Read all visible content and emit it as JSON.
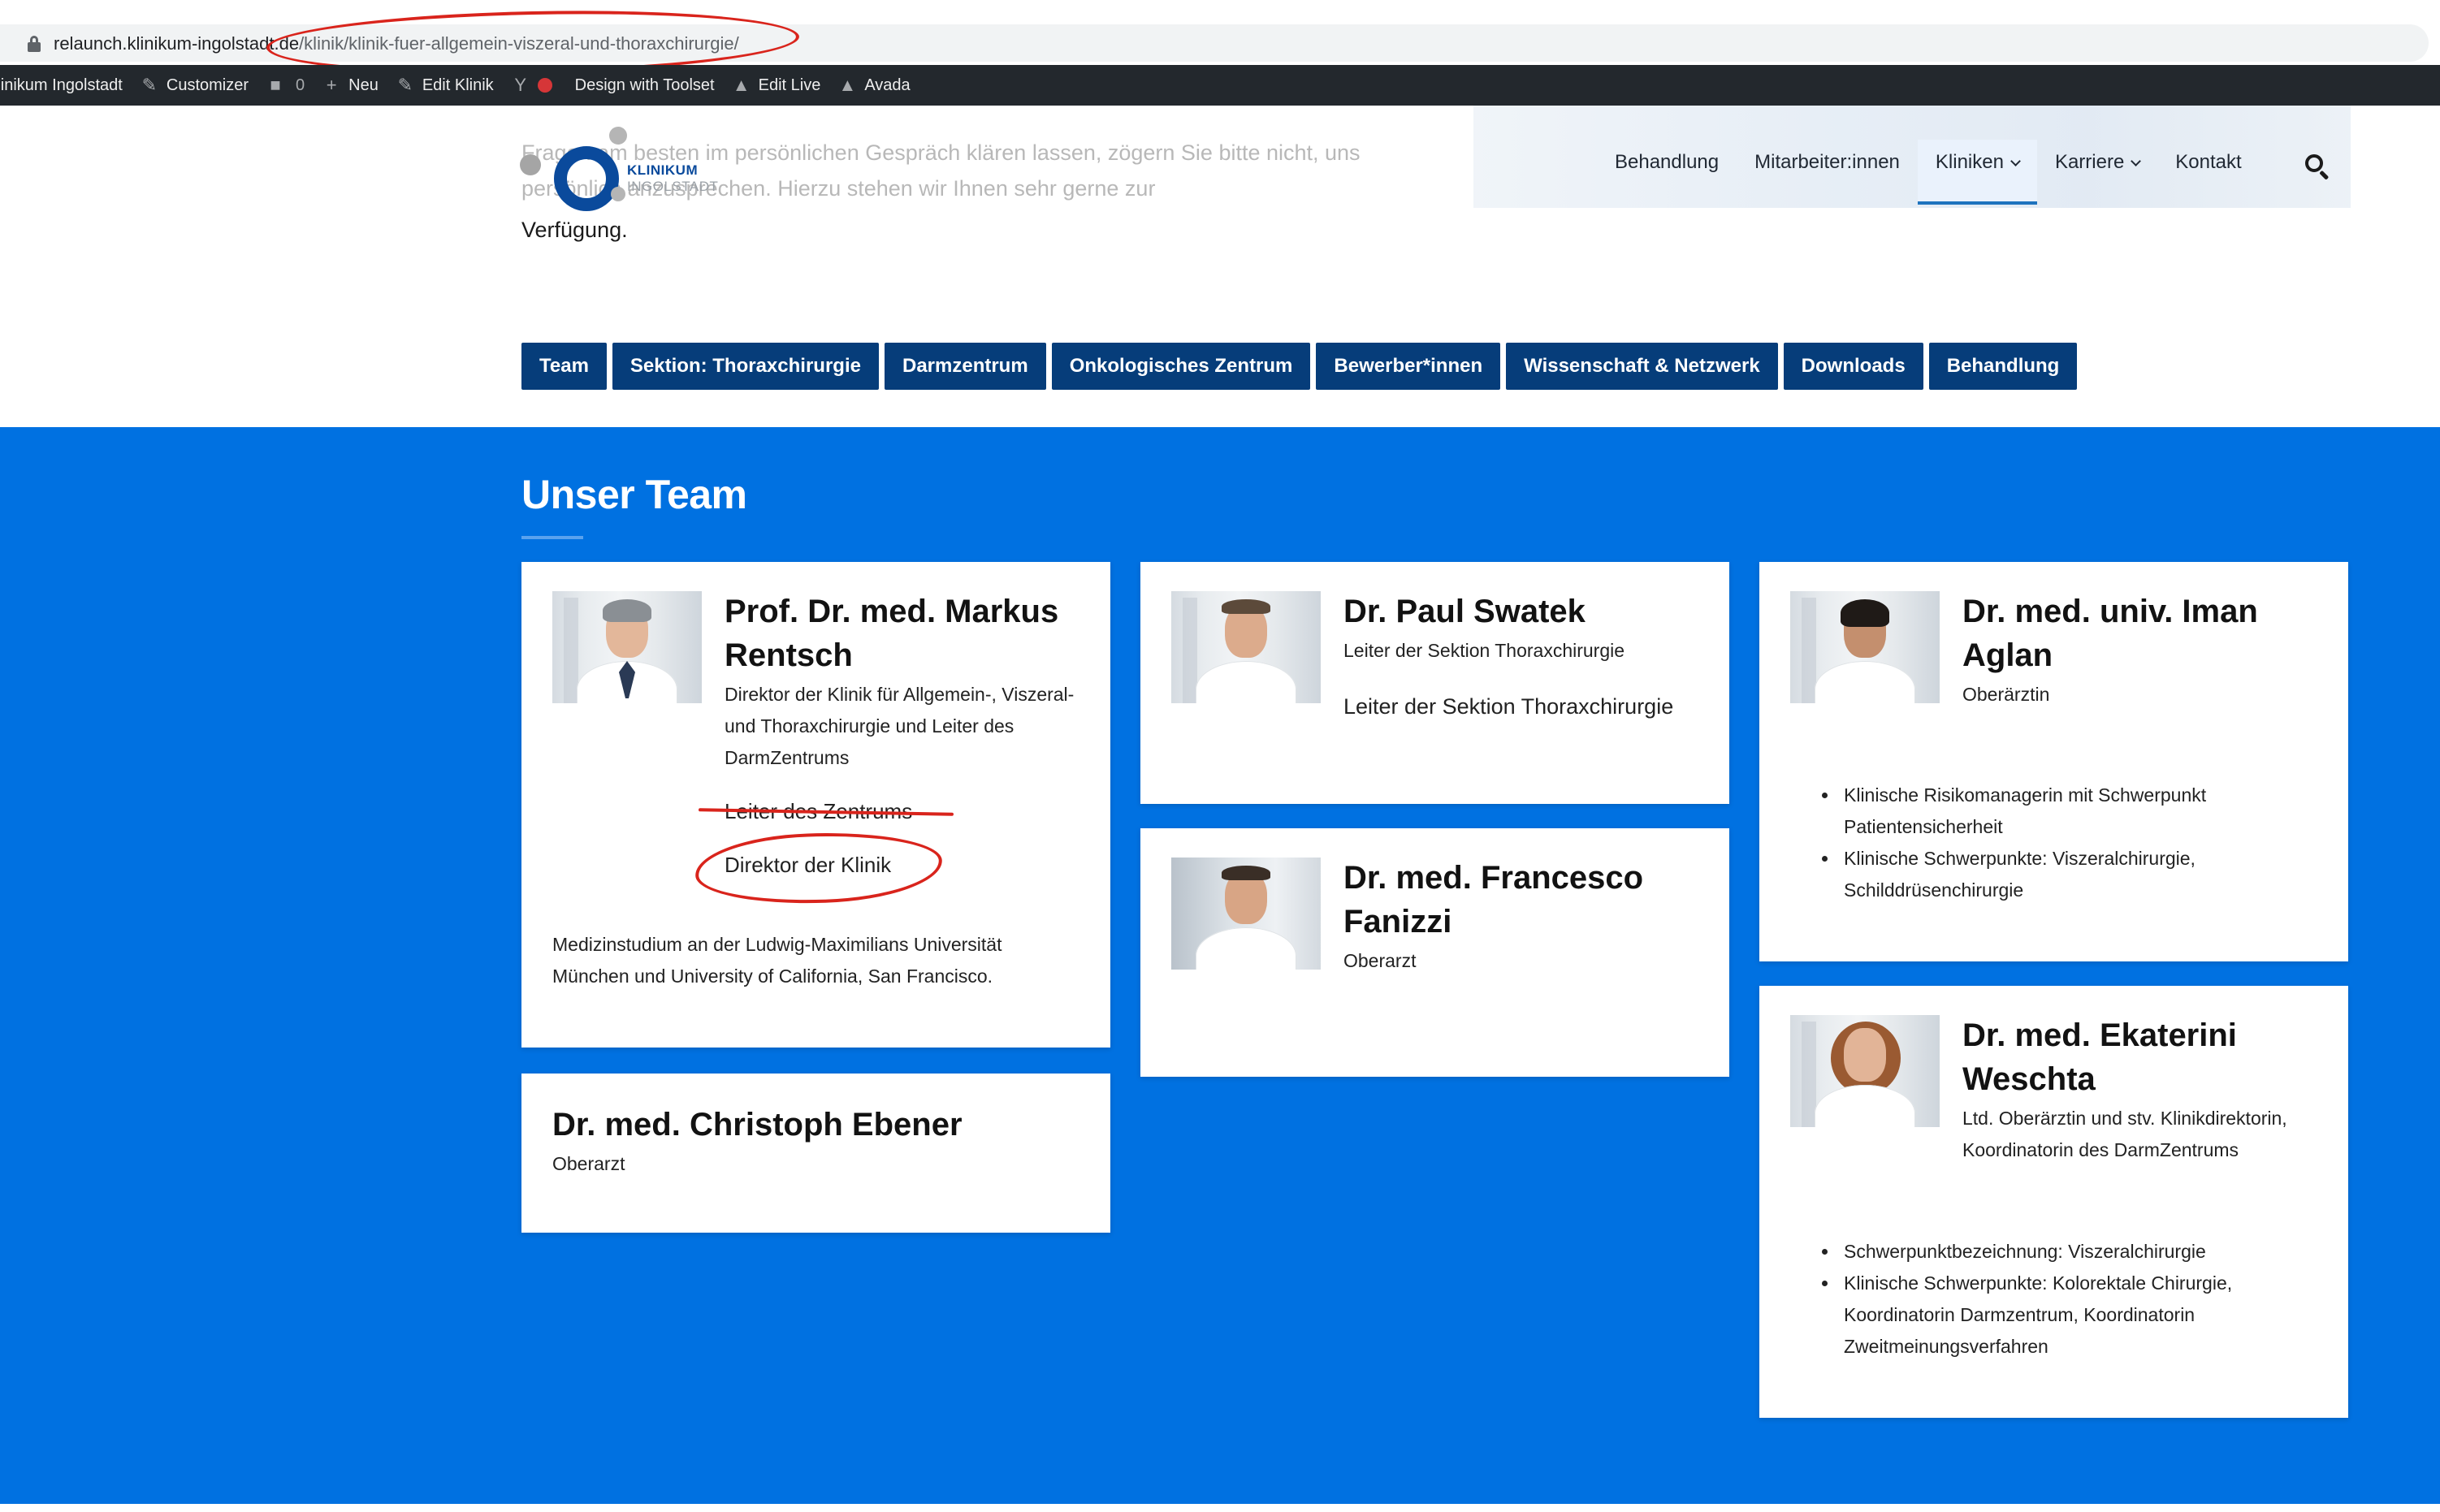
{
  "browser": {
    "url_host": "relaunch.klinikum-ingolstadt.de",
    "url_path": "/klinik/klinik-fuer-allgemein-viszeral-und-thoraxchirurgie/"
  },
  "adminbar": {
    "site": "Klinikum Ingolstadt",
    "customizer": "Customizer",
    "comments": "0",
    "new": "Neu",
    "edit": "Edit Klinik",
    "toolset": "Design with Toolset",
    "edit_live": "Edit Live",
    "avada": "Avada"
  },
  "header": {
    "logo_line1": "KLINIKUM",
    "logo_line2": "INGOLSTADT",
    "intro_faded": "Fragen am besten im persönlichen Gespräch klären lassen, zögern Sie bitte nicht, uns persönlich anzusprechen. Hierzu stehen wir Ihnen sehr gerne zur",
    "intro_last": "Verfügung.",
    "nav": [
      {
        "label": "Behandlung"
      },
      {
        "label": "Mitarbeiter:innen"
      },
      {
        "label": "Kliniken"
      },
      {
        "label": "Karriere"
      },
      {
        "label": "Kontakt"
      }
    ]
  },
  "tabs": [
    "Team",
    "Sektion: Thoraxchirurgie",
    "Darmzentrum",
    "Onkologisches Zentrum",
    "Bewerber*innen",
    "Wissenschaft & Netzwerk",
    "Downloads",
    "Behandlung"
  ],
  "section": {
    "title": "Unser Team"
  },
  "team": {
    "rentsch": {
      "name": "Prof. Dr. med. Markus Rentsch",
      "role": "Direktor der Klinik für Allgemein-, Viszeral- und Thoraxchirurgie und Leiter des DarmZentrums",
      "struck": "Leiter des Zentrums",
      "corrected": "Direktor der Klinik",
      "bio": "Medizinstudium an der Ludwig-Maximilians Universität München und University of California, San Francisco."
    },
    "ebener": {
      "name": "Dr. med. Christoph Ebener",
      "role": "Oberarzt"
    },
    "swatek": {
      "name": "Dr. Paul Swatek",
      "role": "Leiter der Sektion Thoraxchirurgie",
      "extra": "Leiter der Sektion Thoraxchirurgie"
    },
    "fanizzi": {
      "name": "Dr. med. Francesco Fanizzi",
      "role": "Oberarzt"
    },
    "aglan": {
      "name": "Dr. med. univ. Iman Aglan",
      "role": "Oberärztin",
      "bullets": [
        "Klinische Risikomanagerin mit Schwerpunkt Patientensicherheit",
        "Klinische Schwerpunkte: Viszeralchirurgie, Schilddrüsenchirurgie"
      ]
    },
    "weschta": {
      "name": "Dr. med. Ekaterini Weschta",
      "role": "Ltd. Oberärztin und stv. Klinikdirektorin, Koordinatorin des DarmZentrums",
      "bullets": [
        "Schwerpunktbezeichnung: Viszeralchirurgie",
        "Klinische Schwerpunkte: Kolorektale Chirurgie, Koordinatorin Darmzentrum, Koordinatorin Zweitmeinungsverfahren"
      ]
    }
  },
  "colors": {
    "section_blue": "#0071e1",
    "tab_navy": "#063d7a",
    "annotation_red": "#d9241c"
  }
}
